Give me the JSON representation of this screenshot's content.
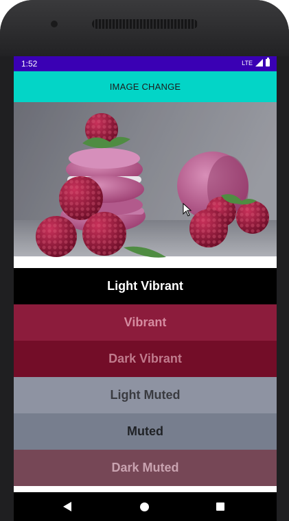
{
  "status_bar": {
    "time": "1:52",
    "network": "LTE",
    "background": "#3a00b4"
  },
  "toolbar": {
    "button_label": "IMAGE CHANGE",
    "background": "#03d5c7"
  },
  "image": {
    "icon": "macarons-raspberries-photo"
  },
  "swatches": [
    {
      "label": "Light Vibrant",
      "background": "#000000",
      "text_color": "#ffffff"
    },
    {
      "label": "Vibrant",
      "background": "#8c1c3c",
      "text_color": "#d58ba0"
    },
    {
      "label": "Dark Vibrant",
      "background": "#730d28",
      "text_color": "#c07a8c"
    },
    {
      "label": "Light Muted",
      "background": "#8e93a2",
      "text_color": "#3a3b40"
    },
    {
      "label": "Muted",
      "background": "#777e8e",
      "text_color": "#202226"
    },
    {
      "label": "Dark Muted",
      "background": "#764756",
      "text_color": "#c9a3b0"
    }
  ],
  "nav_bar": {
    "back_icon": "back-triangle-icon",
    "home_icon": "home-circle-icon",
    "recents_icon": "recents-square-icon"
  }
}
